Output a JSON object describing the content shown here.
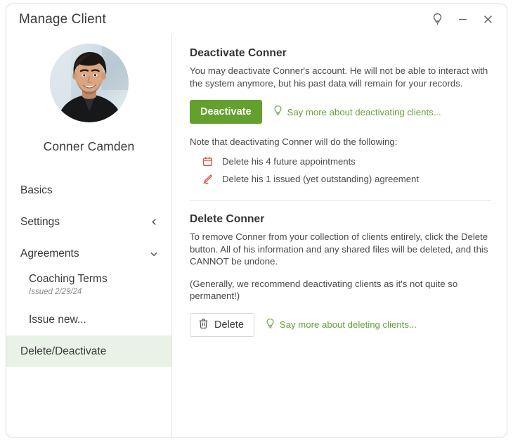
{
  "window": {
    "title": "Manage Client",
    "controls": [
      {
        "name": "tips-lightbulb",
        "label": "Tips"
      },
      {
        "name": "minimize",
        "label": "Minimize"
      },
      {
        "name": "close",
        "label": "Close"
      }
    ]
  },
  "sidebar": {
    "client_name": "Conner Camden",
    "avatar_alt": "Conner Camden profile photo",
    "items": [
      {
        "label": "Basics",
        "chevron": "",
        "selected": false
      },
      {
        "label": "Settings",
        "chevron": "left",
        "selected": false
      },
      {
        "label": "Agreements",
        "chevron": "down",
        "selected": false
      }
    ],
    "agreement_entry": {
      "title": "Coaching Terms",
      "meta": "Issued 2/29/24"
    },
    "issue_new_label": "Issue new...",
    "delete_deactivate": {
      "label": "Delete/Deactivate",
      "selected": true
    }
  },
  "deactivate_section": {
    "title": "Deactivate Conner",
    "description": "You may deactivate Conner's account. He will not be able to interact with the system anymore, but his past data will remain for your records.",
    "button_label": "Deactivate",
    "hint_link": "Say more about deactivating clients...",
    "note_label": "Note that deactivating Conner will do the following:",
    "effects": [
      {
        "icon": "calendar-icon",
        "text": "Delete his 4 future appointments"
      },
      {
        "icon": "signature-pen-icon",
        "text": "Delete his 1 issued (yet outstanding) agreement"
      }
    ]
  },
  "delete_section": {
    "title": "Delete Conner",
    "description": "To remove Conner from your collection of clients entirely, click the Delete button. All of his information and any shared files will be deleted, and this CANNOT be undone.",
    "recommendation": "(Generally, we recommend deactivating clients as it's not quite so permanent!)",
    "button_label": "Delete",
    "hint_link": "Say more about deleting clients..."
  },
  "colors": {
    "accent_green": "#64a02e",
    "link_green": "#63a13a",
    "selected_row": "#eaf1e6",
    "danger_red": "#e04a3f",
    "text_primary": "#3a3a3a",
    "text_secondary": "#4a4a4a",
    "border": "#e4e4e4"
  }
}
